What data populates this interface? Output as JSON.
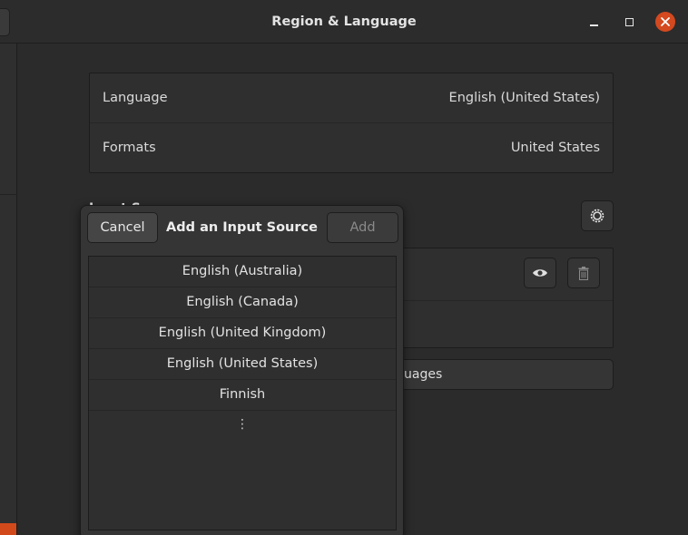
{
  "window": {
    "title": "Region & Language",
    "minimize_label": "minimize",
    "maximize_label": "maximize",
    "close_label": "close"
  },
  "language_list": {
    "language_label": "Language",
    "language_value": "English (United States)",
    "formats_label": "Formats",
    "formats_value": "United States"
  },
  "input_sources": {
    "section_label": "Input Sources",
    "manage_button_label": "Manage Installed Languages"
  },
  "popover": {
    "cancel_label": "Cancel",
    "title": "Add an Input Source",
    "add_label": "Add",
    "items": [
      "English (Australia)",
      "English (Canada)",
      "English (United Kingdom)",
      "English (United States)",
      "Finnish"
    ],
    "more_label": "⋮"
  },
  "colors": {
    "accent": "#d24a1b",
    "close_button": "#d4491f"
  },
  "icons": [
    "gear-icon",
    "eye-icon",
    "trash-icon",
    "close-icon",
    "minimize-icon",
    "maximize-icon",
    "more-icon"
  ]
}
